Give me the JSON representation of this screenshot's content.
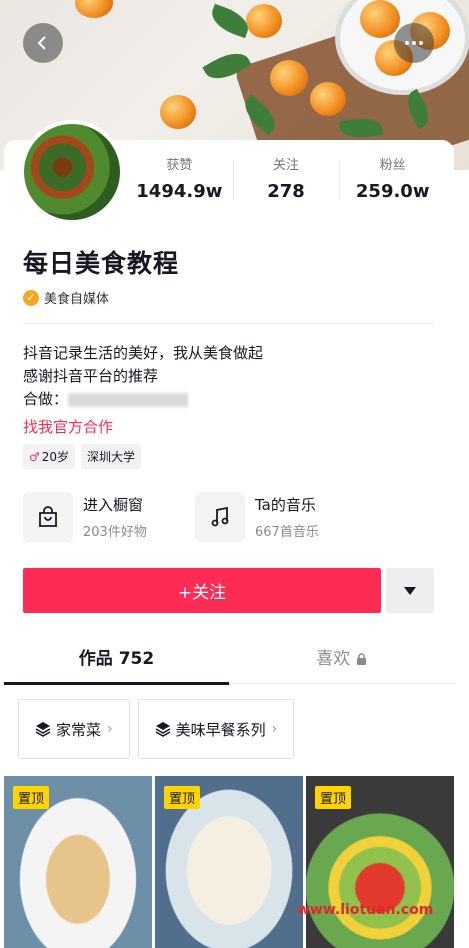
{
  "colors": {
    "accent": "#fe2c55",
    "pin": "#ffd400",
    "verify": "#f5a623"
  },
  "header": {
    "back_icon": "chevron-left-icon",
    "more_icon": "ellipsis-icon"
  },
  "stats": [
    {
      "label": "获赞",
      "value": "1494.9w"
    },
    {
      "label": "关注",
      "value": "278"
    },
    {
      "label": "粉丝",
      "value": "259.0w"
    }
  ],
  "profile": {
    "name": "每日美食教程",
    "verified_label": "美食自媒体",
    "bio_line1": "抖音记录生活的美好，我从美食做起",
    "bio_line2": "感谢抖音平台的推荐",
    "contact_label": "合做：",
    "collab_link": "找我官方合作",
    "tags": [
      {
        "icon": "♂",
        "label": "20岁"
      },
      {
        "label": "深圳大学"
      }
    ]
  },
  "entries": [
    {
      "title": "进入橱窗",
      "subtitle": "203件好物",
      "icon": "shopping-bag-icon"
    },
    {
      "title": "Ta的音乐",
      "subtitle": "667首音乐",
      "icon": "music-note-icon"
    }
  ],
  "actions": {
    "follow_label": "+关注",
    "dropdown_icon": "caret-down-icon"
  },
  "tabs": [
    {
      "label": "作品 752"
    },
    {
      "label": "喜欢"
    }
  ],
  "collections": [
    {
      "label": "家常菜"
    },
    {
      "label": "美味早餐系列"
    }
  ],
  "grid": [
    {
      "badge": "置顶"
    },
    {
      "badge": "置顶"
    },
    {
      "badge": "置顶"
    }
  ],
  "watermark": "www.liotuan.com"
}
